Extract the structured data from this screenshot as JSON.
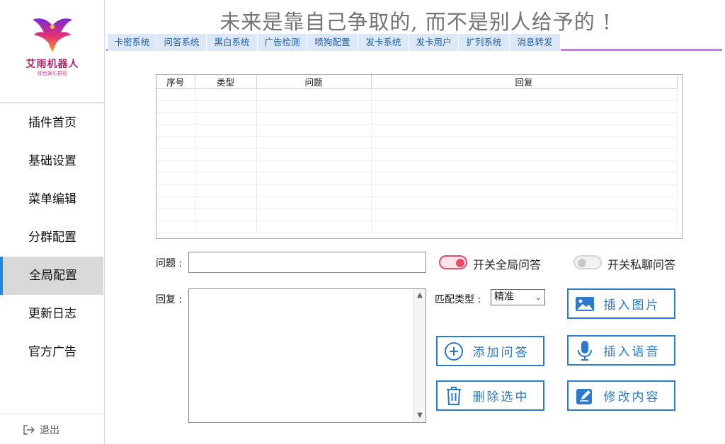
{
  "sidebar": {
    "logo_title": "艾雨机器人",
    "logo_subtitle": "综合娱乐群管",
    "items": [
      {
        "label": "插件首页"
      },
      {
        "label": "基础设置"
      },
      {
        "label": "菜单编辑"
      },
      {
        "label": "分群配置"
      },
      {
        "label": "全局配置",
        "active": true
      },
      {
        "label": "更新日志"
      },
      {
        "label": "官方广告"
      }
    ],
    "logout_label": "退出"
  },
  "header": {
    "banner": "未来是靠自己争取的, 而不是别人给予的 !"
  },
  "tabs": [
    "卡密系统",
    "问答系统",
    "黑白系统",
    "广告检测",
    "喷狗配置",
    "发卡系统",
    "发卡用户",
    "扩列系统",
    "消息转发"
  ],
  "table": {
    "columns": [
      "序号",
      "类型",
      "问题",
      "回复"
    ],
    "rows": []
  },
  "form": {
    "question_label": "问题 :",
    "question_value": "",
    "reply_label": "回复 :",
    "reply_value": "",
    "toggle_global_label": "开关全局问答",
    "toggle_global_on": true,
    "toggle_private_label": "开关私聊问答",
    "toggle_private_on": false,
    "match_type_label": "匹配类型 :",
    "match_type_value": "精准"
  },
  "buttons": {
    "insert_image": "插入图片",
    "add_qa": "添加问答",
    "insert_voice": "插入语音",
    "delete_selected": "删除选中",
    "edit_content": "修改内容"
  },
  "colors": {
    "accent_blue": "#2b7ad0",
    "tab_bg": "#dce8f7",
    "tab_underline": "#c37be8",
    "toggle_on": "#e0506a"
  }
}
